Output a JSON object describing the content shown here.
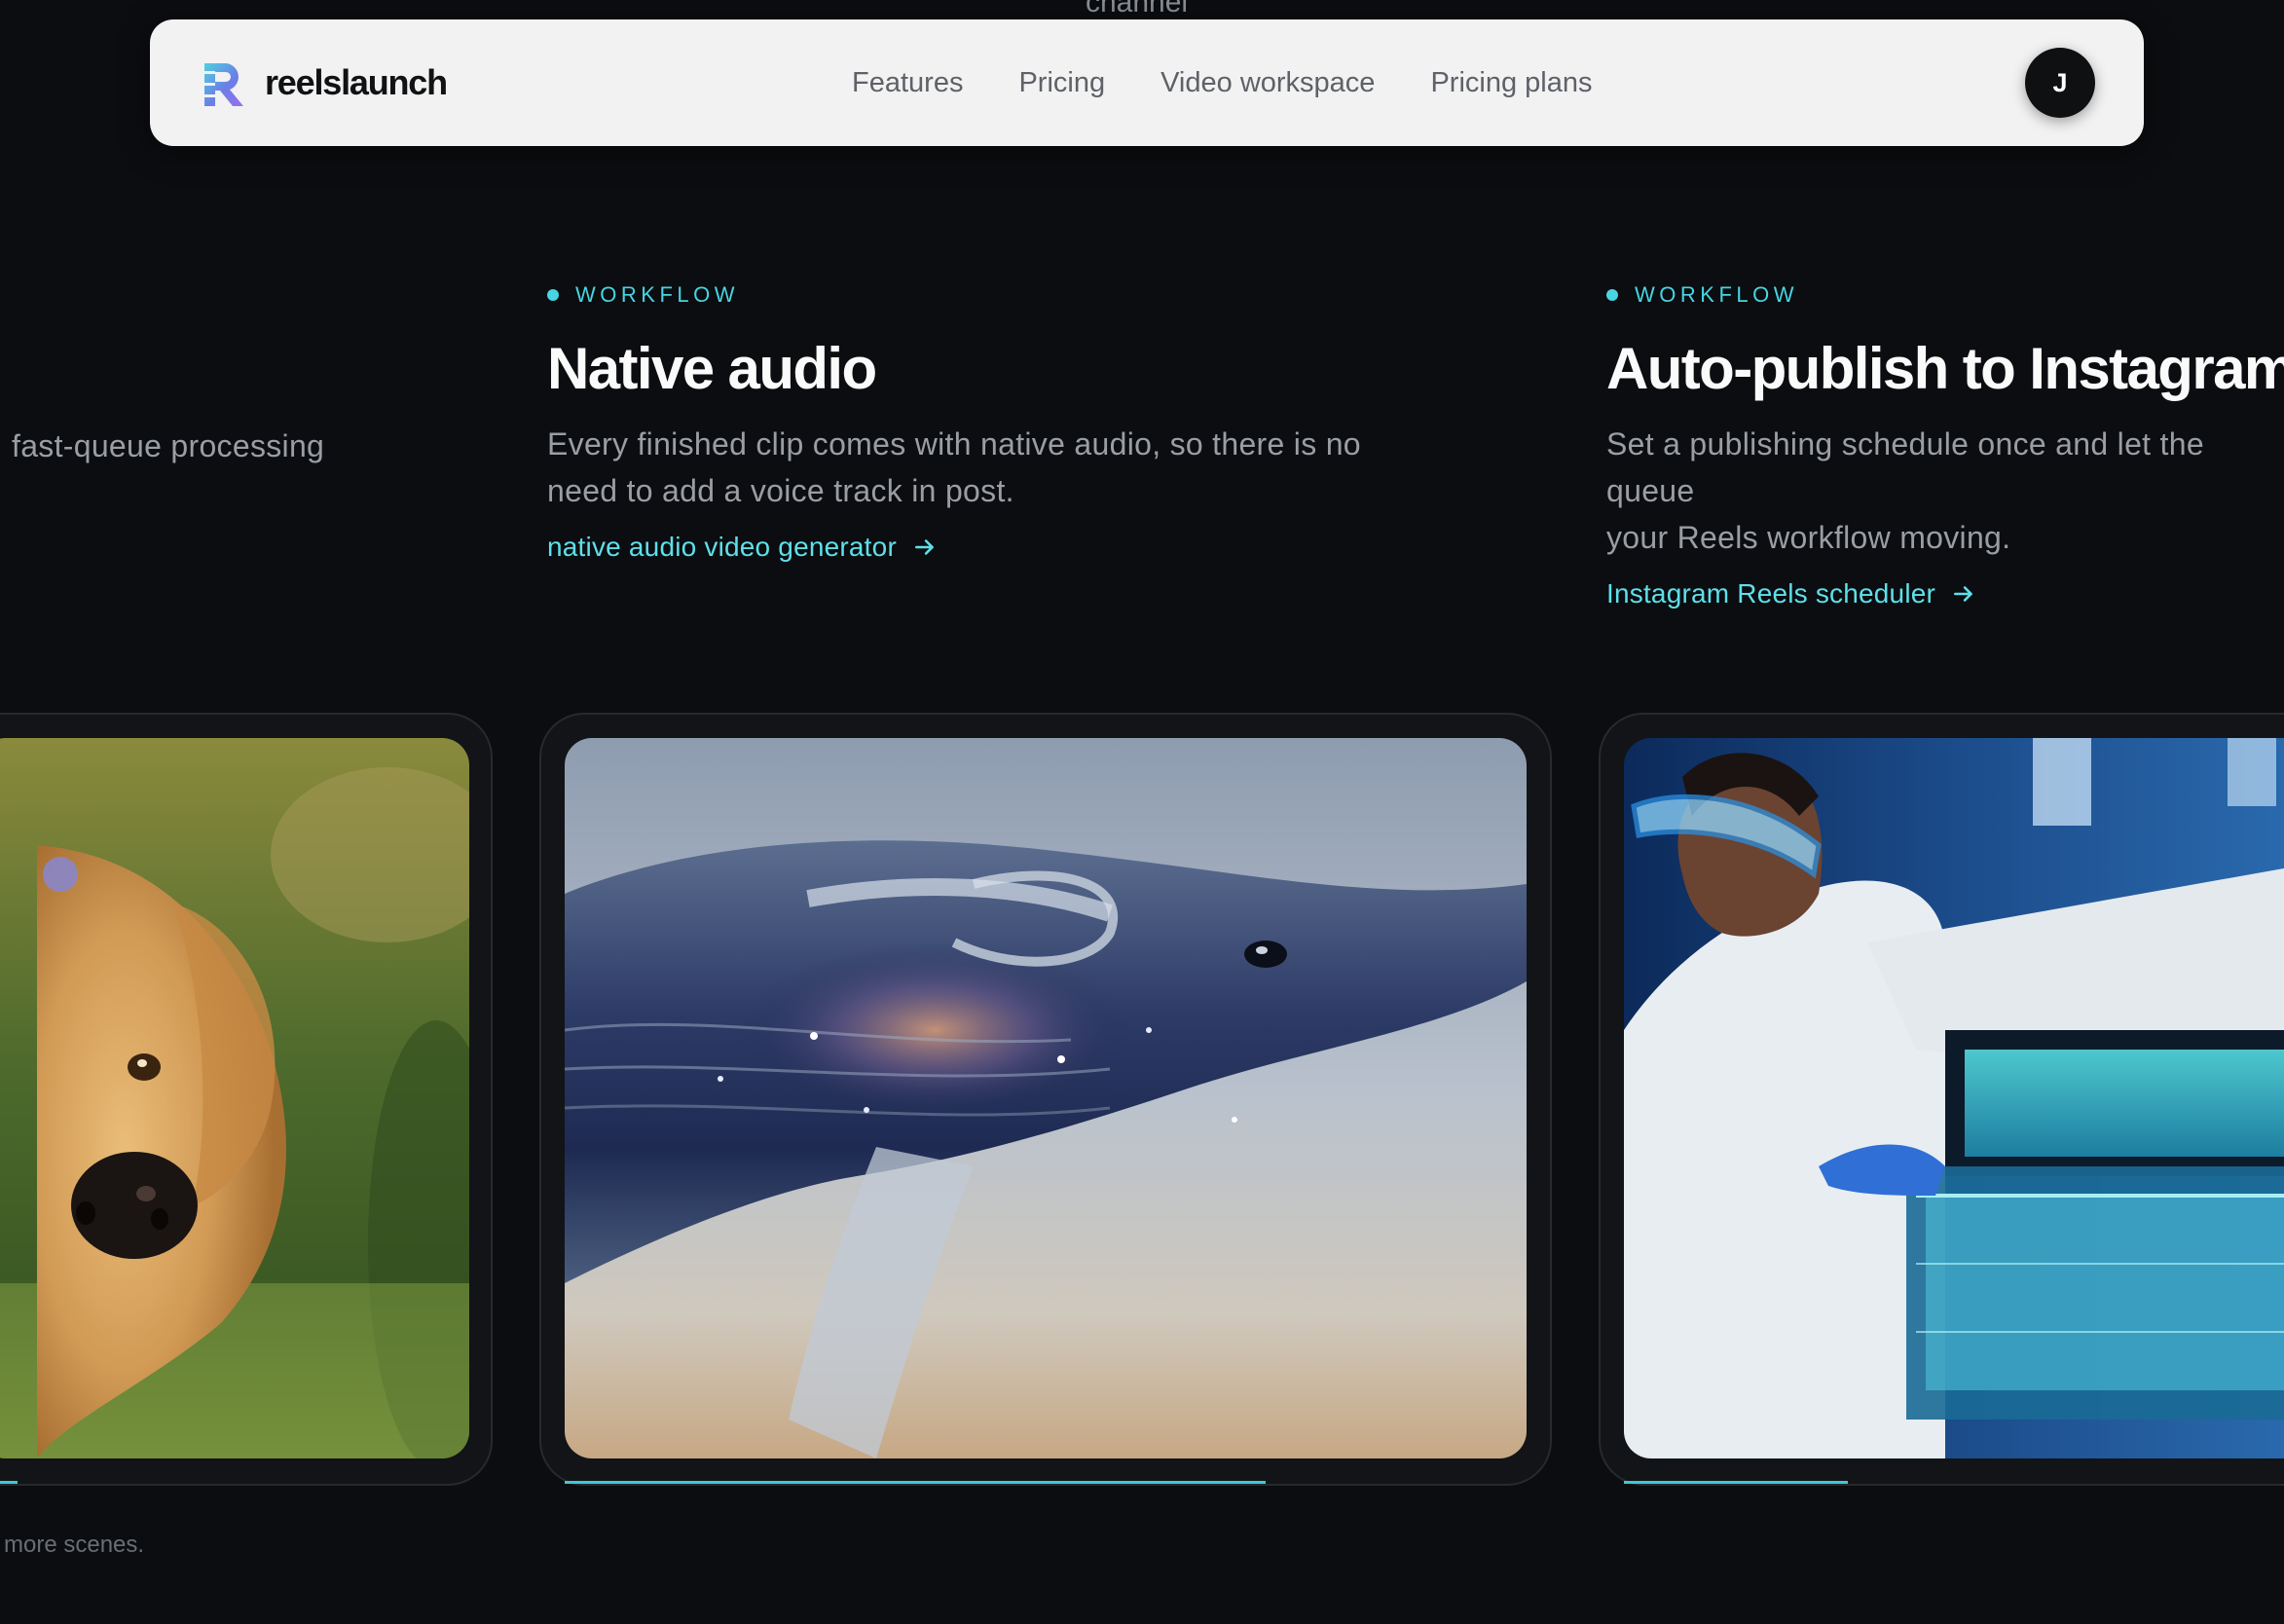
{
  "top_clip_text": "channel",
  "navbar": {
    "brand": "reelslaunch",
    "links": [
      "Features",
      "Pricing",
      "Video workspace",
      "Pricing plans"
    ],
    "avatar_initial": "J"
  },
  "features": {
    "left_partial_desc": "fast-queue processing",
    "center": {
      "eyebrow": "WORKFLOW",
      "title": "Native audio",
      "desc_line1": "Every finished clip comes with native audio, so there is no",
      "desc_line2": "need to add a voice track in post.",
      "link": "native audio video generator"
    },
    "right": {
      "eyebrow": "WORKFLOW",
      "title": "Auto-publish to Instagram",
      "desc_line1": "Set a publishing schedule once and let the queue",
      "desc_line2": "your Reels workflow moving.",
      "link": "Instagram Reels scheduler"
    }
  },
  "footnote": "more scenes.",
  "colors": {
    "accent": "#48d4e1",
    "background": "#0b0d10",
    "navbar": "#f2f2f2"
  }
}
